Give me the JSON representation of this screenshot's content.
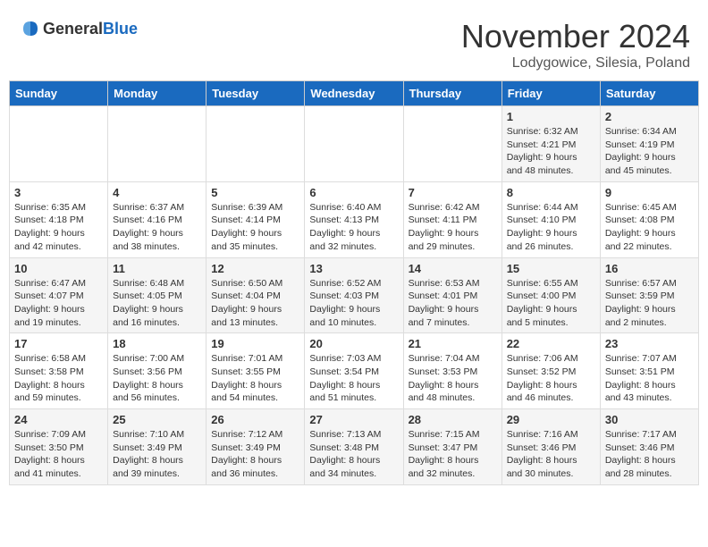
{
  "logo": {
    "general": "General",
    "blue": "Blue"
  },
  "title": "November 2024",
  "subtitle": "Lodygowice, Silesia, Poland",
  "headers": [
    "Sunday",
    "Monday",
    "Tuesday",
    "Wednesday",
    "Thursday",
    "Friday",
    "Saturday"
  ],
  "weeks": [
    {
      "days": [
        {
          "num": "",
          "info": ""
        },
        {
          "num": "",
          "info": ""
        },
        {
          "num": "",
          "info": ""
        },
        {
          "num": "",
          "info": ""
        },
        {
          "num": "",
          "info": ""
        },
        {
          "num": "1",
          "info": "Sunrise: 6:32 AM\nSunset: 4:21 PM\nDaylight: 9 hours and 48 minutes."
        },
        {
          "num": "2",
          "info": "Sunrise: 6:34 AM\nSunset: 4:19 PM\nDaylight: 9 hours and 45 minutes."
        }
      ]
    },
    {
      "days": [
        {
          "num": "3",
          "info": "Sunrise: 6:35 AM\nSunset: 4:18 PM\nDaylight: 9 hours and 42 minutes."
        },
        {
          "num": "4",
          "info": "Sunrise: 6:37 AM\nSunset: 4:16 PM\nDaylight: 9 hours and 38 minutes."
        },
        {
          "num": "5",
          "info": "Sunrise: 6:39 AM\nSunset: 4:14 PM\nDaylight: 9 hours and 35 minutes."
        },
        {
          "num": "6",
          "info": "Sunrise: 6:40 AM\nSunset: 4:13 PM\nDaylight: 9 hours and 32 minutes."
        },
        {
          "num": "7",
          "info": "Sunrise: 6:42 AM\nSunset: 4:11 PM\nDaylight: 9 hours and 29 minutes."
        },
        {
          "num": "8",
          "info": "Sunrise: 6:44 AM\nSunset: 4:10 PM\nDaylight: 9 hours and 26 minutes."
        },
        {
          "num": "9",
          "info": "Sunrise: 6:45 AM\nSunset: 4:08 PM\nDaylight: 9 hours and 22 minutes."
        }
      ]
    },
    {
      "days": [
        {
          "num": "10",
          "info": "Sunrise: 6:47 AM\nSunset: 4:07 PM\nDaylight: 9 hours and 19 minutes."
        },
        {
          "num": "11",
          "info": "Sunrise: 6:48 AM\nSunset: 4:05 PM\nDaylight: 9 hours and 16 minutes."
        },
        {
          "num": "12",
          "info": "Sunrise: 6:50 AM\nSunset: 4:04 PM\nDaylight: 9 hours and 13 minutes."
        },
        {
          "num": "13",
          "info": "Sunrise: 6:52 AM\nSunset: 4:03 PM\nDaylight: 9 hours and 10 minutes."
        },
        {
          "num": "14",
          "info": "Sunrise: 6:53 AM\nSunset: 4:01 PM\nDaylight: 9 hours and 7 minutes."
        },
        {
          "num": "15",
          "info": "Sunrise: 6:55 AM\nSunset: 4:00 PM\nDaylight: 9 hours and 5 minutes."
        },
        {
          "num": "16",
          "info": "Sunrise: 6:57 AM\nSunset: 3:59 PM\nDaylight: 9 hours and 2 minutes."
        }
      ]
    },
    {
      "days": [
        {
          "num": "17",
          "info": "Sunrise: 6:58 AM\nSunset: 3:58 PM\nDaylight: 8 hours and 59 minutes."
        },
        {
          "num": "18",
          "info": "Sunrise: 7:00 AM\nSunset: 3:56 PM\nDaylight: 8 hours and 56 minutes."
        },
        {
          "num": "19",
          "info": "Sunrise: 7:01 AM\nSunset: 3:55 PM\nDaylight: 8 hours and 54 minutes."
        },
        {
          "num": "20",
          "info": "Sunrise: 7:03 AM\nSunset: 3:54 PM\nDaylight: 8 hours and 51 minutes."
        },
        {
          "num": "21",
          "info": "Sunrise: 7:04 AM\nSunset: 3:53 PM\nDaylight: 8 hours and 48 minutes."
        },
        {
          "num": "22",
          "info": "Sunrise: 7:06 AM\nSunset: 3:52 PM\nDaylight: 8 hours and 46 minutes."
        },
        {
          "num": "23",
          "info": "Sunrise: 7:07 AM\nSunset: 3:51 PM\nDaylight: 8 hours and 43 minutes."
        }
      ]
    },
    {
      "days": [
        {
          "num": "24",
          "info": "Sunrise: 7:09 AM\nSunset: 3:50 PM\nDaylight: 8 hours and 41 minutes."
        },
        {
          "num": "25",
          "info": "Sunrise: 7:10 AM\nSunset: 3:49 PM\nDaylight: 8 hours and 39 minutes."
        },
        {
          "num": "26",
          "info": "Sunrise: 7:12 AM\nSunset: 3:49 PM\nDaylight: 8 hours and 36 minutes."
        },
        {
          "num": "27",
          "info": "Sunrise: 7:13 AM\nSunset: 3:48 PM\nDaylight: 8 hours and 34 minutes."
        },
        {
          "num": "28",
          "info": "Sunrise: 7:15 AM\nSunset: 3:47 PM\nDaylight: 8 hours and 32 minutes."
        },
        {
          "num": "29",
          "info": "Sunrise: 7:16 AM\nSunset: 3:46 PM\nDaylight: 8 hours and 30 minutes."
        },
        {
          "num": "30",
          "info": "Sunrise: 7:17 AM\nSunset: 3:46 PM\nDaylight: 8 hours and 28 minutes."
        }
      ]
    }
  ]
}
